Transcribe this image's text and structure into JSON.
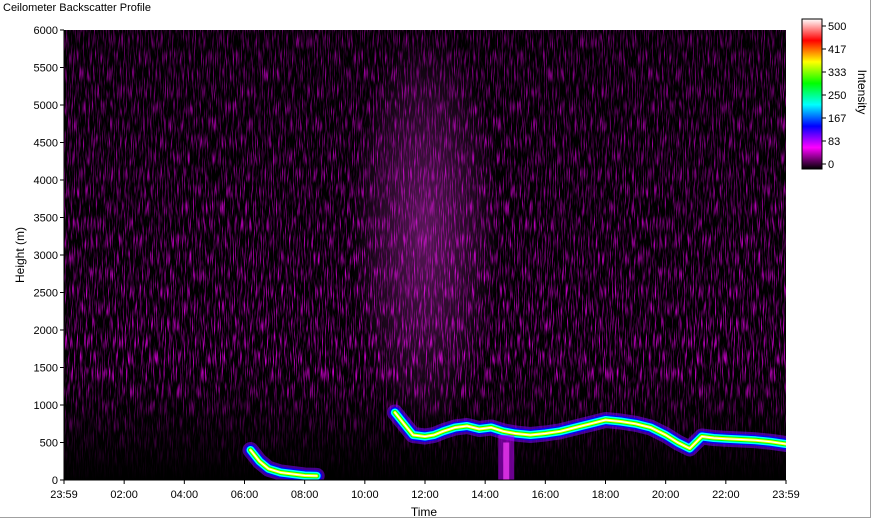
{
  "window": {
    "title": "Ceilometer Backscatter Profile"
  },
  "chart_data": {
    "type": "heatmap",
    "title": "",
    "xlabel": "Time",
    "ylabel": "Height (m)",
    "xlim": [
      "23:59",
      "23:59"
    ],
    "ylim": [
      0,
      6000
    ],
    "x_tick_labels": [
      "23:59",
      "02:00",
      "04:00",
      "06:00",
      "08:00",
      "10:00",
      "12:00",
      "14:00",
      "16:00",
      "18:00",
      "20:00",
      "22:00",
      "23:59"
    ],
    "y_ticks": [
      0,
      500,
      1000,
      1500,
      2000,
      2500,
      3000,
      3500,
      4000,
      4500,
      5000,
      5500,
      6000
    ],
    "colorbar": {
      "label": "Intensity",
      "range": [
        0,
        500
      ],
      "tick_labels": [
        "0",
        "83",
        "167",
        "250",
        "333",
        "417",
        "500"
      ],
      "colors": [
        "#000000",
        "#ff00ff",
        "#0000ff",
        "#00ffff",
        "#00ff00",
        "#ffff00",
        "#ff0000",
        "#ffffff"
      ]
    },
    "cloud_layer": {
      "description_units": "time (h since start), height (m)",
      "points": [
        [
          6.2,
          400
        ],
        [
          6.5,
          250
        ],
        [
          6.8,
          150
        ],
        [
          7.2,
          100
        ],
        [
          7.6,
          80
        ],
        [
          8.0,
          60
        ],
        [
          8.4,
          55
        ],
        [
          11.0,
          900
        ],
        [
          11.3,
          750
        ],
        [
          11.6,
          600
        ],
        [
          12.0,
          580
        ],
        [
          12.3,
          600
        ],
        [
          12.6,
          650
        ],
        [
          13.0,
          700
        ],
        [
          13.4,
          720
        ],
        [
          13.8,
          680
        ],
        [
          14.2,
          700
        ],
        [
          14.6,
          650
        ],
        [
          15.0,
          620
        ],
        [
          15.5,
          600
        ],
        [
          16.0,
          620
        ],
        [
          16.5,
          650
        ],
        [
          17.0,
          700
        ],
        [
          17.5,
          750
        ],
        [
          18.0,
          800
        ],
        [
          18.5,
          780
        ],
        [
          19.0,
          750
        ],
        [
          19.5,
          700
        ],
        [
          20.0,
          600
        ],
        [
          20.4,
          500
        ],
        [
          20.8,
          420
        ],
        [
          21.2,
          580
        ],
        [
          21.6,
          560
        ],
        [
          22.0,
          550
        ],
        [
          22.5,
          540
        ],
        [
          23.0,
          530
        ],
        [
          23.5,
          510
        ],
        [
          24.0,
          480
        ]
      ]
    },
    "grid": false,
    "legend": "colorbar right"
  }
}
